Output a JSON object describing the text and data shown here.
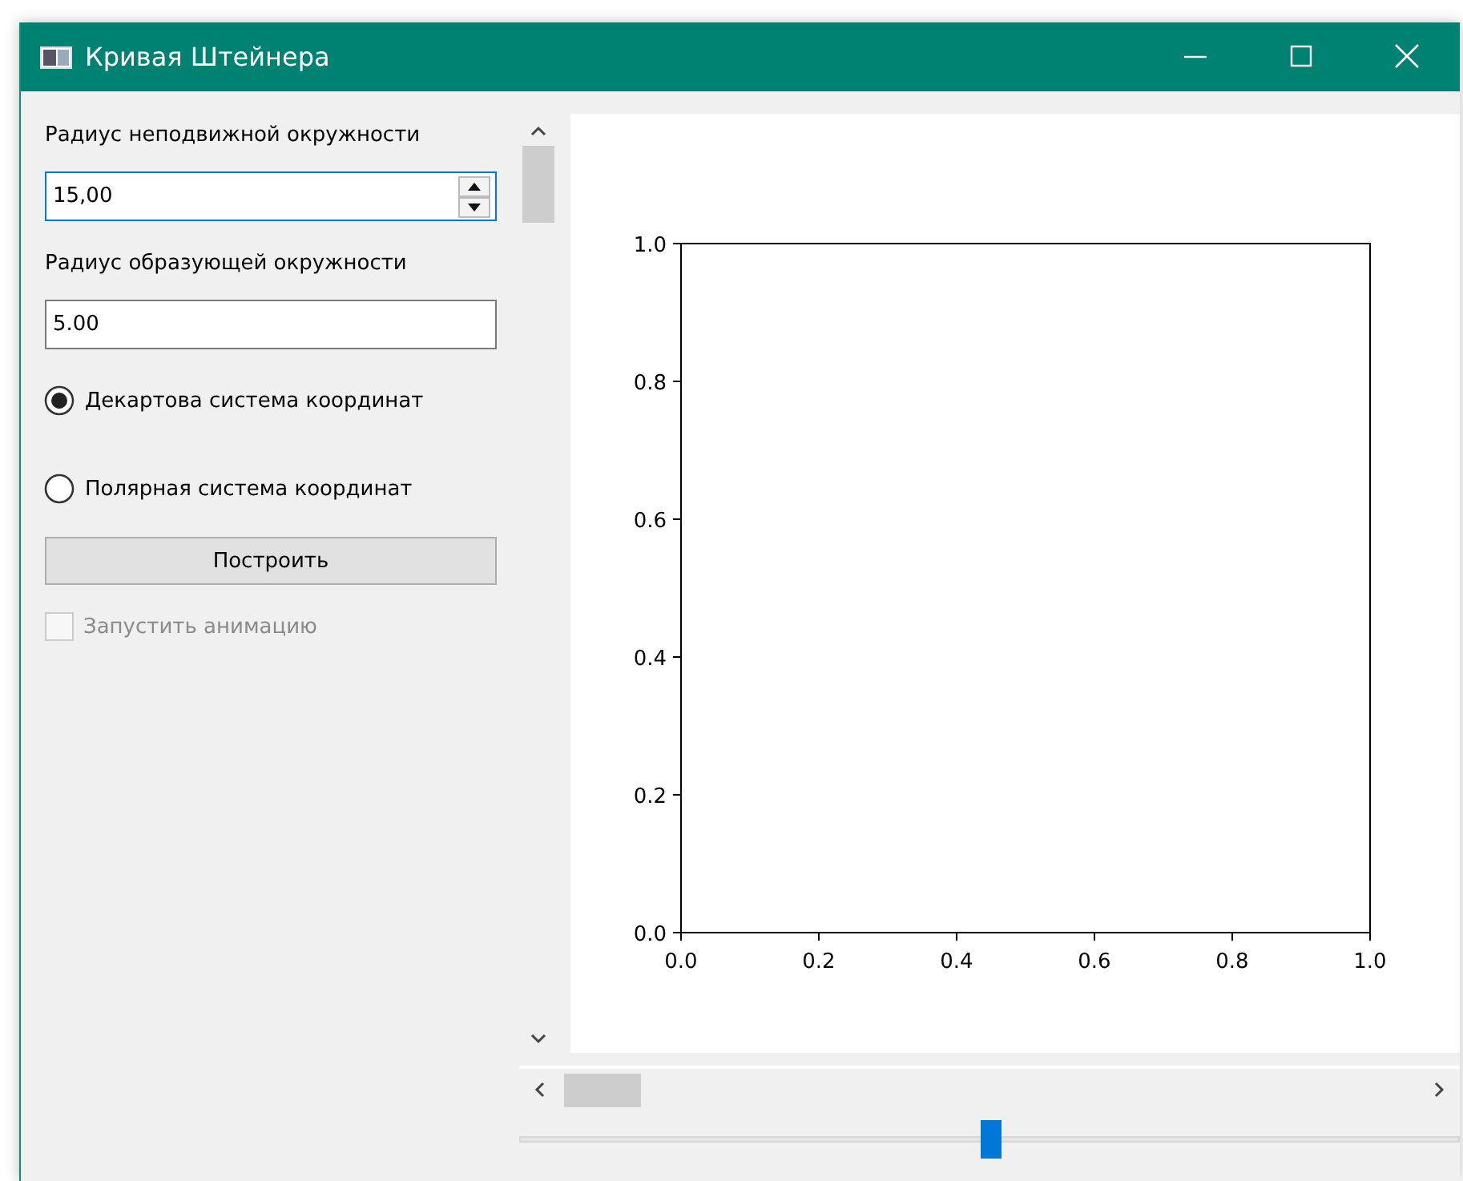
{
  "window": {
    "title": "Кривая Штейнера"
  },
  "controls": [
    {
      "kind": "label",
      "text": "Радиус неподвижной окружности"
    },
    {
      "kind": "spinbox",
      "value": "15,00",
      "focused": true
    },
    {
      "kind": "label",
      "text": "Радиус образующей окружности"
    },
    {
      "kind": "input",
      "value": "5.00",
      "focused": false
    },
    {
      "kind": "radio",
      "text": "Декартова система координат",
      "selected": true
    },
    {
      "kind": "radio",
      "text": "Полярная система координат",
      "selected": false
    },
    {
      "kind": "button",
      "text": "Построить"
    },
    {
      "kind": "checkbox",
      "text": "Запустить анимацию",
      "checked": false,
      "disabled": true
    }
  ],
  "plot": {
    "chart_data": {
      "type": "line",
      "xlim": [
        0,
        1
      ],
      "ylim": [
        0,
        1
      ],
      "xticks": [
        {
          "value": 0,
          "label": "0.0"
        },
        {
          "value": 0.2,
          "label": "0.2"
        },
        {
          "value": 0.4,
          "label": "0.4"
        },
        {
          "value": 0.6,
          "label": "0.6"
        },
        {
          "value": 0.8,
          "label": "0.8"
        },
        {
          "value": 1,
          "label": "1.0"
        }
      ],
      "yticks": [
        {
          "value": 0,
          "label": "0.0"
        },
        {
          "value": 0.2,
          "label": "0.2"
        },
        {
          "value": 0.4,
          "label": "0.4"
        },
        {
          "value": 0.6,
          "label": "0.6"
        },
        {
          "value": 0.8,
          "label": "0.8"
        },
        {
          "value": 1,
          "label": "1.0"
        }
      ]
    }
  },
  "slider": {
    "level": 0.5
  }
}
